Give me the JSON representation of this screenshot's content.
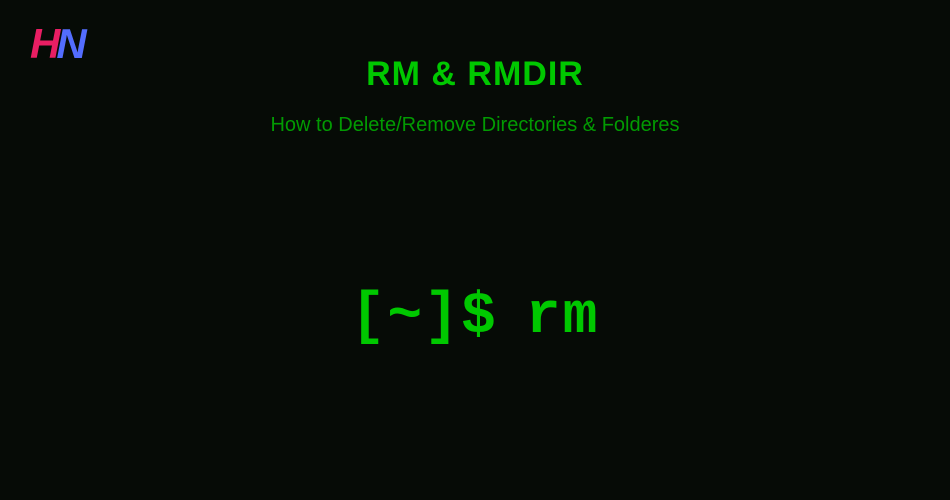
{
  "logo": {
    "letter1": "H",
    "letter2": "N"
  },
  "header": {
    "title": "RM & RMDIR",
    "subtitle": "How to Delete/Remove Directories & Folderes"
  },
  "terminal": {
    "prompt": "[~]$",
    "command": "rm"
  }
}
